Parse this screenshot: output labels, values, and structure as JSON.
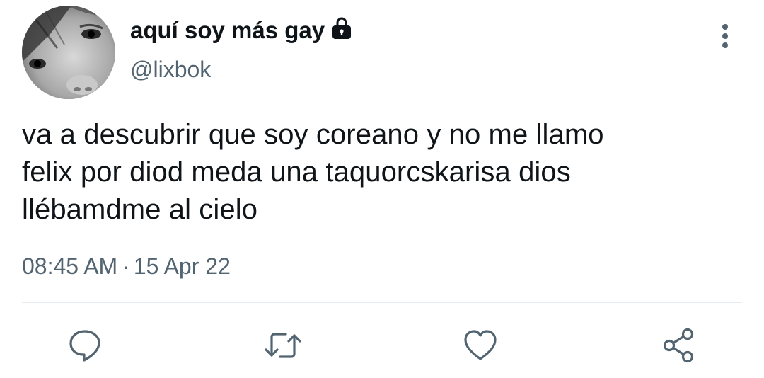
{
  "tweet": {
    "author": {
      "display_name": "aquí soy más gay",
      "handle": "@lixbok",
      "protected_icon": "lock-icon"
    },
    "text": "va a descubrir que soy coreano y no me llamo\nfelix por diod meda una taquorcskarisa dios\nllébamdme al cielo",
    "time": "08:45 AM",
    "separator": "·",
    "date": "15 Apr 22"
  },
  "actions": [
    {
      "icon": "reply-icon"
    },
    {
      "icon": "retweet-icon"
    },
    {
      "icon": "like-icon"
    },
    {
      "icon": "share-icon"
    }
  ],
  "colors": {
    "text": "#0f1419",
    "secondary": "#536471",
    "divider": "#e6ecf0"
  }
}
